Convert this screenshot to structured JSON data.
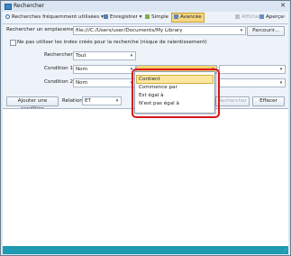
{
  "window": {
    "title": "Rechercher"
  },
  "toolbar": {
    "frequent": "Recherches fréquemment utilisées",
    "save": "Enregistrer",
    "simple": "Simple",
    "advanced": "Avancée",
    "display": "Afficher",
    "preview": "Aperçu"
  },
  "location": {
    "label": "Rechercher un emplacement :",
    "value": "file:///C:/Users/user/Documents/My Library",
    "browse": "Parcourir..."
  },
  "index_option": {
    "label": "Ne pas utiliser les index créés pour la recherche (risque de ralentissement)"
  },
  "search_field": {
    "label": "Rechercher :",
    "value": "Tout"
  },
  "condition1": {
    "label": "Condition 1 :",
    "field": "Nom"
  },
  "condition2": {
    "label": "Condition 2 :",
    "field": "Nom"
  },
  "actions": {
    "add": "Ajouter une condition",
    "relation_label": "Relation :",
    "relation": "ET",
    "search": "Rechercher",
    "clear": "Effacer"
  },
  "operator_menu": {
    "items": [
      "Contient",
      "Commence par",
      "Est égal à",
      "N'est pas égal à"
    ],
    "selected_index": 0
  },
  "colors": {
    "highlight": "#d9141c",
    "accent": "#1f9ab0"
  }
}
